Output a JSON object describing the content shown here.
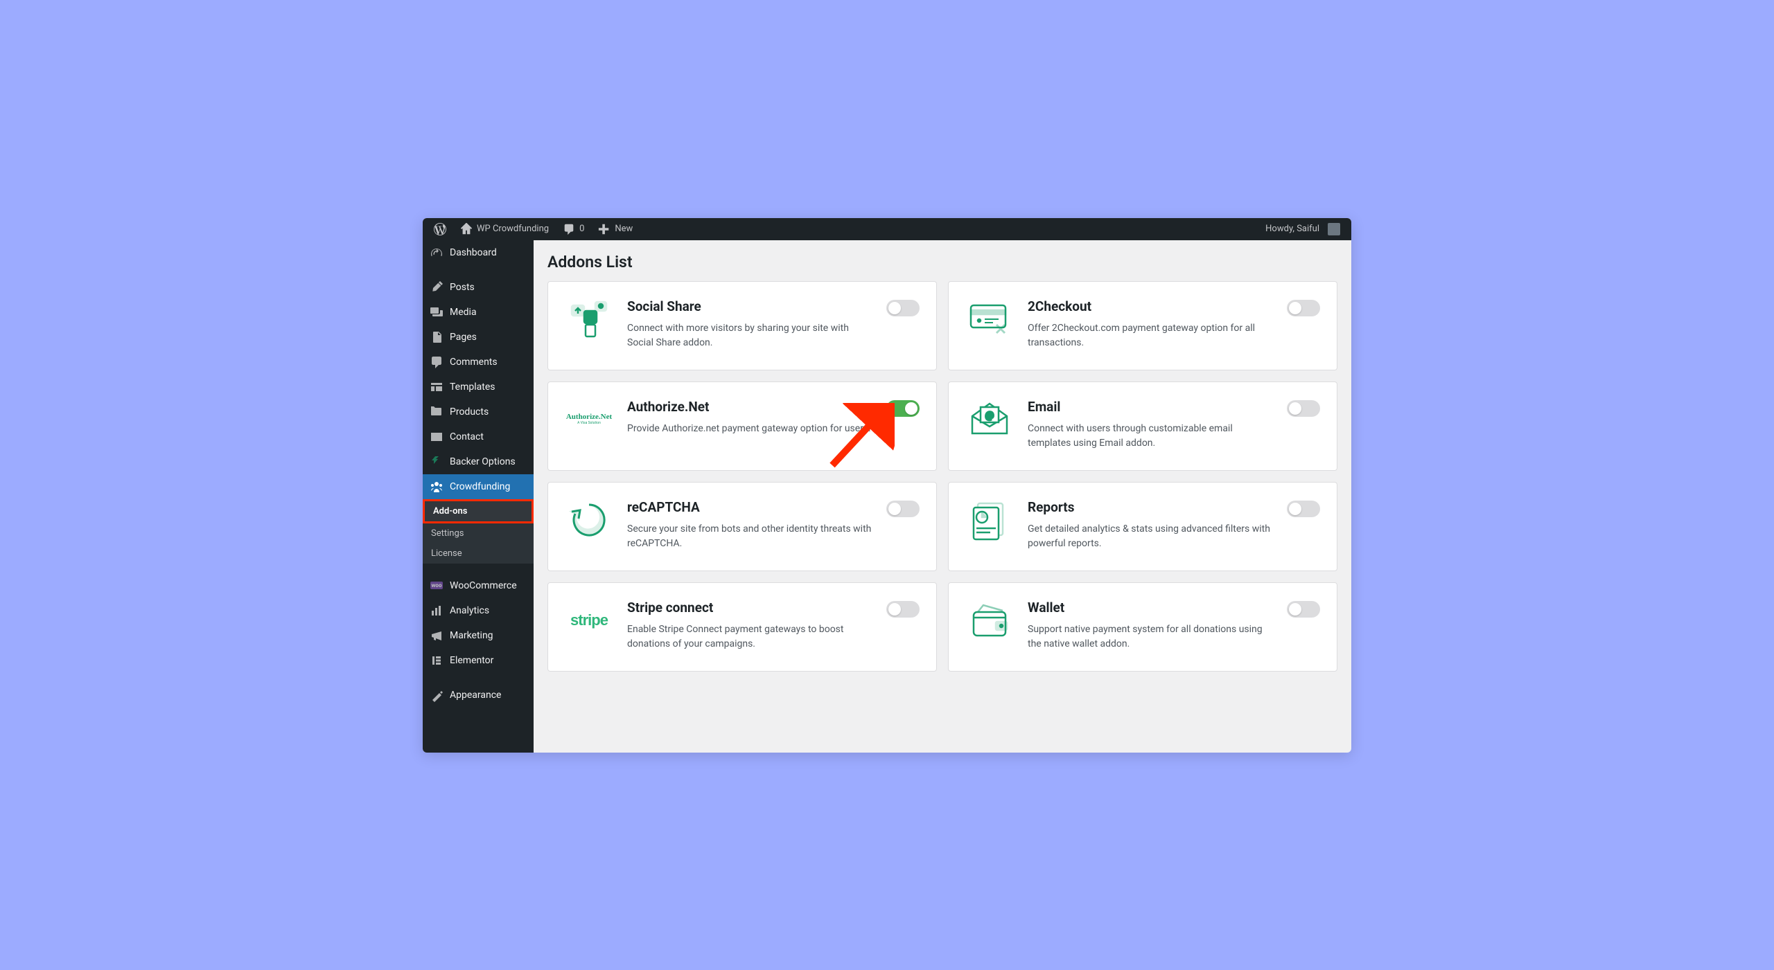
{
  "admin_bar": {
    "site_title": "WP Crowdfunding",
    "comments_count": "0",
    "new_label": "New",
    "howdy": "Howdy, Saiful"
  },
  "sidebar": {
    "items": [
      {
        "label": "Dashboard",
        "icon": "dashboard"
      },
      {
        "label": "Posts",
        "icon": "pin"
      },
      {
        "label": "Media",
        "icon": "media"
      },
      {
        "label": "Pages",
        "icon": "page"
      },
      {
        "label": "Comments",
        "icon": "comment"
      },
      {
        "label": "Templates",
        "icon": "templates"
      },
      {
        "label": "Products",
        "icon": "products"
      },
      {
        "label": "Contact",
        "icon": "contact"
      },
      {
        "label": "Backer Options",
        "icon": "backer"
      },
      {
        "label": "Crowdfunding",
        "icon": "crowdfunding",
        "current": true
      },
      {
        "label": "WooCommerce",
        "icon": "woo"
      },
      {
        "label": "Analytics",
        "icon": "analytics"
      },
      {
        "label": "Marketing",
        "icon": "marketing"
      },
      {
        "label": "Elementor",
        "icon": "elementor"
      },
      {
        "label": "Appearance",
        "icon": "appearance"
      }
    ],
    "crowdfunding_submenu": [
      {
        "label": "Add-ons",
        "active": true
      },
      {
        "label": "Settings"
      },
      {
        "label": "License"
      }
    ]
  },
  "page": {
    "title": "Addons List",
    "addons": [
      {
        "title": "Social Share",
        "desc": "Connect with more visitors by sharing your site with Social Share addon.",
        "enabled": false,
        "icon": "social"
      },
      {
        "title": "2Checkout",
        "desc": "Offer 2Checkout.com payment gateway option for all transactions.",
        "enabled": false,
        "icon": "2checkout"
      },
      {
        "title": "Authorize.Net",
        "desc": "Provide Authorize.net payment gateway option for users.",
        "enabled": true,
        "icon": "authorizenet"
      },
      {
        "title": "Email",
        "desc": "Connect with users through customizable email templates using Email addon.",
        "enabled": false,
        "icon": "email"
      },
      {
        "title": "reCAPTCHA",
        "desc": "Secure your site from bots and other identity threats with reCAPTCHA.",
        "enabled": false,
        "icon": "recaptcha"
      },
      {
        "title": "Reports",
        "desc": "Get detailed analytics & stats using advanced filters with powerful reports.",
        "enabled": false,
        "icon": "reports"
      },
      {
        "title": "Stripe connect",
        "desc": "Enable Stripe Connect payment gateways to boost donations of your campaigns.",
        "enabled": false,
        "icon": "stripe"
      },
      {
        "title": "Wallet",
        "desc": "Support native payment system for all donations using the native wallet addon.",
        "enabled": false,
        "icon": "wallet"
      }
    ]
  }
}
